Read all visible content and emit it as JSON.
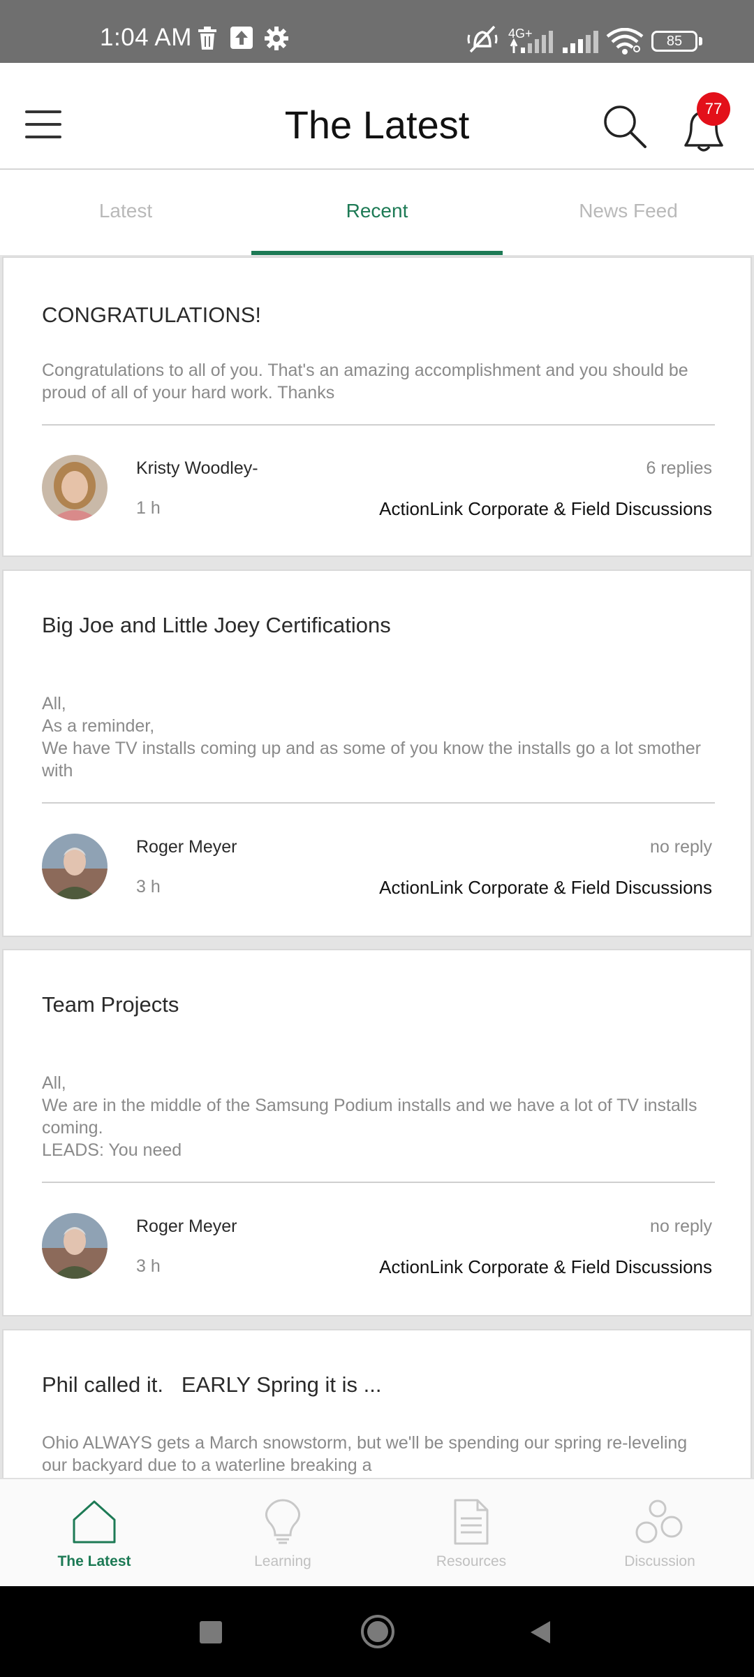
{
  "status_bar": {
    "time": "1:04 AM",
    "network": "4G+",
    "battery": "85",
    "icons": [
      "trash-icon",
      "upload-icon",
      "settings-gear-icon",
      "mute-vibrate-icon",
      "cell-signal-icon",
      "wifi-icon"
    ]
  },
  "header": {
    "title": "The Latest",
    "notification_count": "77",
    "icons": [
      "menu-icon",
      "search-icon",
      "bell-icon"
    ]
  },
  "tabs": [
    {
      "label": "Latest",
      "active": false
    },
    {
      "label": "Recent",
      "active": true
    },
    {
      "label": "News Feed",
      "active": false
    }
  ],
  "accent_color": "#1d7a55",
  "badge_color": "#e3101a",
  "posts": [
    {
      "title": "CONGRATULATIONS!",
      "body": "Congratulations to all of you. That's an amazing accomplishment and you should be proud of all of your hard work. Thanks",
      "author": "Kristy Woodley-",
      "time": "1 h",
      "replies": "6 replies",
      "group": "ActionLink Corporate & Field Discussions"
    },
    {
      "title": "Big Joe and Little Joey Certifications",
      "body": "All,\nAs a reminder,\nWe have TV installs coming up and as some of you know the installs go a lot smother with",
      "author": "Roger Meyer",
      "time": "3 h",
      "replies": "no reply",
      "group": "ActionLink Corporate & Field Discussions"
    },
    {
      "title": "Team Projects",
      "body": "All,\nWe are in the middle of the Samsung Podium installs and we have a lot of TV installs coming.\nLEADS: You need",
      "author": "Roger Meyer",
      "time": "3 h",
      "replies": "no reply",
      "group": "ActionLink Corporate & Field Discussions"
    },
    {
      "title": "Phil called it.   EARLY Spring it is ...",
      "body": "Ohio ALWAYS gets a March snowstorm,  but we'll be spending our spring re-leveling our backyard due to a waterline breaking a"
    }
  ],
  "bottom_nav": [
    {
      "label": "The Latest",
      "icon": "home-icon",
      "active": true
    },
    {
      "label": "Learning",
      "icon": "lightbulb-icon",
      "active": false
    },
    {
      "label": "Resources",
      "icon": "document-icon",
      "active": false
    },
    {
      "label": "Discussion",
      "icon": "bubbles-icon",
      "active": false
    }
  ]
}
